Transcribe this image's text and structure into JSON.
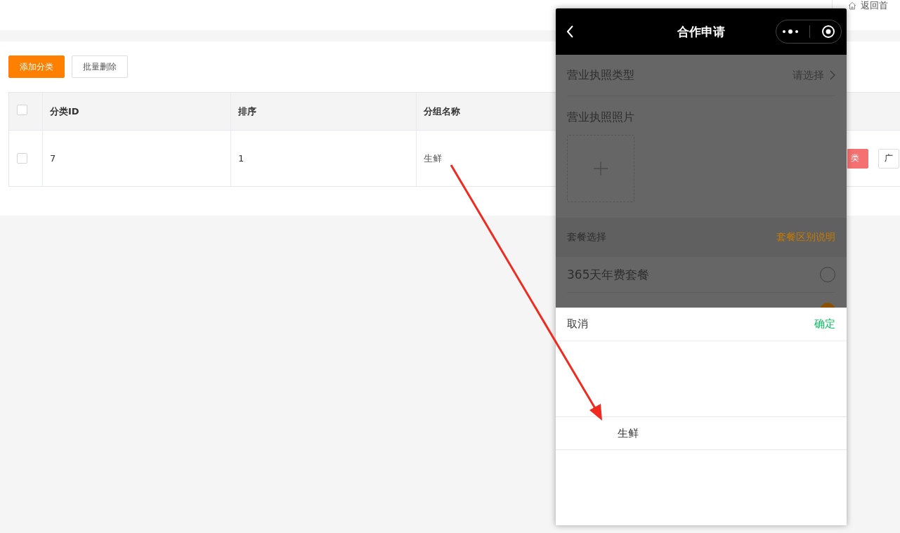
{
  "header": {
    "home_link": "返回首"
  },
  "toolbar": {
    "buttons": [
      {
        "label": "添加分类",
        "kind": "primary"
      },
      {
        "label": "批量删除",
        "kind": "default"
      }
    ]
  },
  "table": {
    "columns": [
      "分类ID",
      "排序",
      "分组名称"
    ],
    "select_all_checked": false,
    "rows": [
      {
        "checked": false,
        "cells": [
          "7",
          "1",
          "生鲜"
        ],
        "actions": [
          {
            "label": "类",
            "kind": "danger"
          },
          {
            "label": "广",
            "kind": "default"
          }
        ]
      }
    ]
  },
  "phone": {
    "title": "合作申请",
    "form": [
      {
        "label": "营业执照类型",
        "value": "请选择"
      }
    ],
    "photo_label": "营业执照照片",
    "plan_section": {
      "label": "套餐选择",
      "link": "套餐区别说明"
    },
    "plans": [
      {
        "label": "365天年费套餐",
        "selected": false
      },
      {
        "selected": true
      }
    ],
    "picker": {
      "cancel": "取消",
      "confirm": "确定",
      "options": [
        {
          "label": "生鲜",
          "selected": true
        }
      ]
    }
  }
}
